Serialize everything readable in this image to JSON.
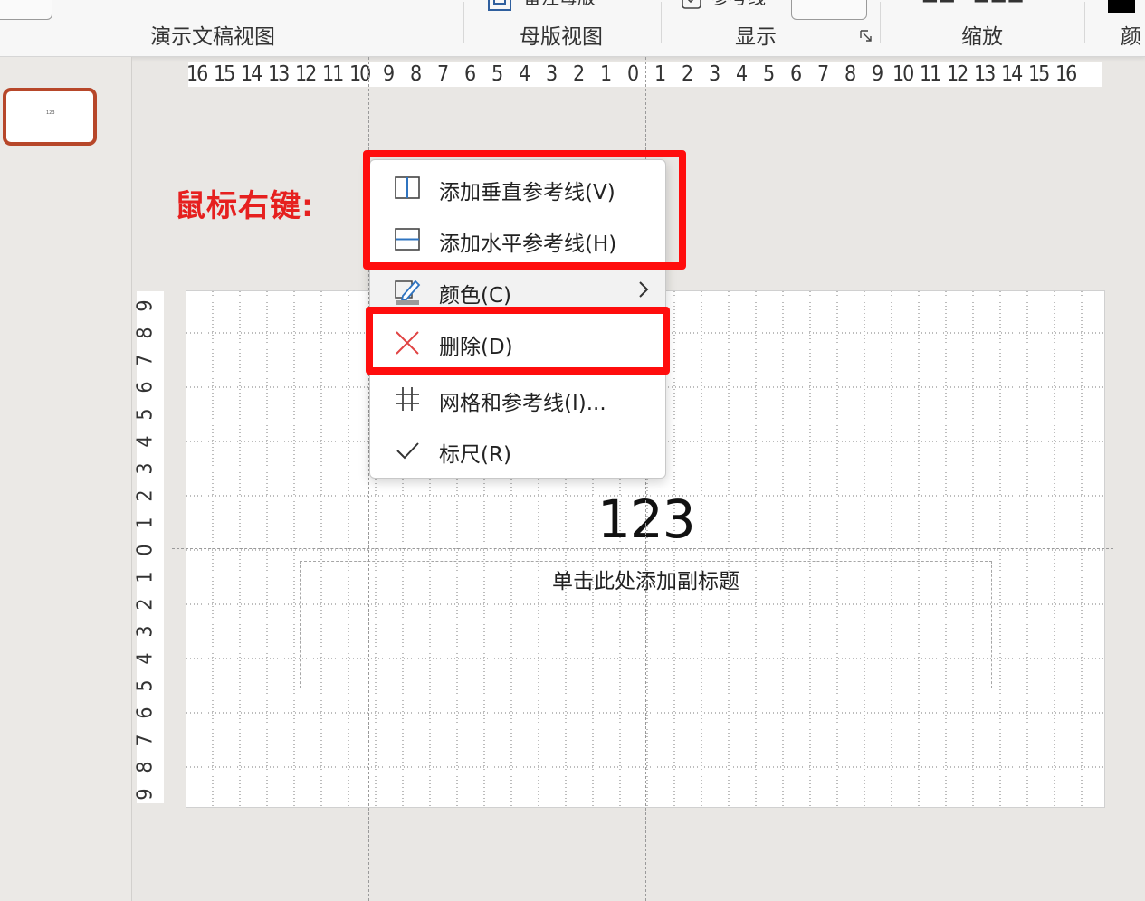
{
  "ribbon": {
    "groups": [
      {
        "label": "演示文稿视图"
      },
      {
        "label": "母版视图"
      },
      {
        "label": "显示"
      },
      {
        "label": "缩放"
      },
      {
        "label": "颜"
      }
    ],
    "cut_items": {
      "notes_master": "备注母版",
      "guides": "参考线"
    },
    "icons": {
      "display_launcher": "dialog-launcher-icon",
      "notes_master": "notes-master-icon",
      "guides_checkbox": "checkbox-icon"
    }
  },
  "thumbnail": {
    "text": "123"
  },
  "ruler_h": [
    "16",
    "15",
    "14",
    "13",
    "12",
    "11",
    "10",
    "9",
    "8",
    "7",
    "6",
    "5",
    "4",
    "3",
    "2",
    "1",
    "0",
    "1",
    "2",
    "3",
    "4",
    "5",
    "6",
    "7",
    "8",
    "9",
    "10",
    "11",
    "12",
    "13",
    "14",
    "15",
    "16"
  ],
  "ruler_v": [
    "9",
    "8",
    "7",
    "6",
    "5",
    "4",
    "3",
    "2",
    "1",
    "0",
    "1",
    "2",
    "3",
    "4",
    "5",
    "6",
    "7",
    "8",
    "9"
  ],
  "annotation": {
    "text": "鼠标右键:",
    "color": "#e6201f"
  },
  "slide": {
    "title": "123",
    "subtitle_placeholder": "单击此处添加副标题"
  },
  "context_menu": {
    "items": [
      {
        "label": "添加垂直参考线(V)",
        "icon": "vertical-guide-icon"
      },
      {
        "label": "添加水平参考线(H)",
        "icon": "horizontal-guide-icon"
      },
      {
        "label": "颜色(C)",
        "icon": "pen-color-icon",
        "submenu": true
      },
      {
        "label": "删除(D)",
        "icon": "delete-x-icon"
      },
      {
        "label": "网格和参考线(I)...",
        "icon": "grid-icon"
      },
      {
        "label": "标尺(R)",
        "icon": "checkmark-icon"
      }
    ]
  },
  "colors": {
    "highlight": "#ff0d0d",
    "delete_icon": "#e04343",
    "thumb_border": "#b7472a"
  }
}
